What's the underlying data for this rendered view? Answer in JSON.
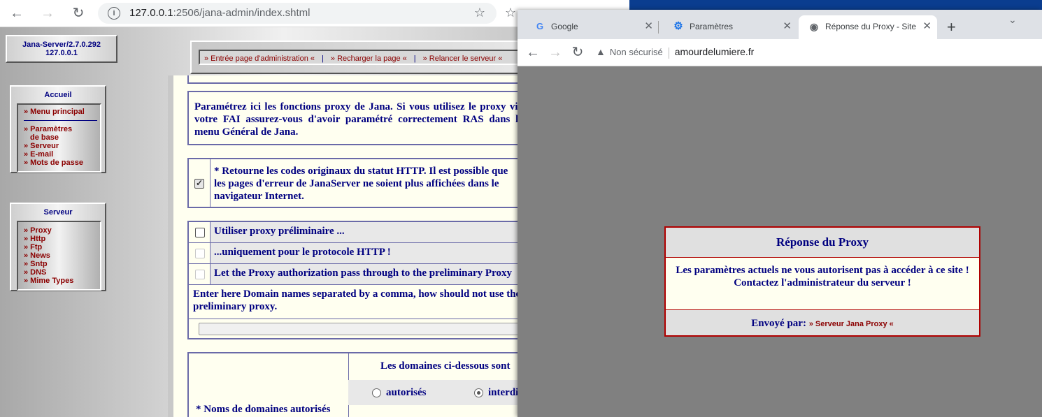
{
  "back_browser": {
    "url_host": "127.0.0.1",
    "url_rest": ":2506/jana-admin/index.shtml"
  },
  "jana": {
    "version_line1": "Jana-Server/2.7.0.292",
    "version_line2": "127.0.0.1",
    "menu_bar": [
      "» Entrée page d'administration «",
      "» Recharger la page «",
      "» Relancer le serveur «"
    ],
    "accueil": {
      "title": "Accueil",
      "items": [
        "» Menu principal",
        "» Paramètres",
        "de base",
        "» Serveur",
        "» E-mail",
        "» Mots de passe"
      ]
    },
    "serveur": {
      "title": "Serveur",
      "items": [
        "» Proxy",
        "» Http",
        "» Ftp",
        "» News",
        "» Sntp",
        "» DNS",
        "» Mime Types"
      ]
    },
    "intro": "Paramétrez ici les fonctions proxy de Jana. Si vous utilisez le proxy via votre FAI assurez-vous d'avoir paramétré correctement RAS dans le menu Général de Jana.",
    "http_codes": "* Retourne les codes originaux du statut HTTP. Il est possible que les pages d'erreur de JanaServer ne soient plus affichées dans le navigateur Internet.",
    "opt1": "Utiliser proxy préliminaire ...",
    "opt2": "...uniquement pour le protocole HTTP !",
    "opt3": "Let the Proxy authorization pass through to the preliminary Proxy",
    "domains_hint": "Enter here Domain names separated by a comma, how should not use the preliminary proxy.",
    "domains_title": "* Noms de domaines autorisés",
    "domains_header": "Les domaines ci-dessous sont",
    "radio_allowed": "autorisés",
    "radio_forbidden": "interdits"
  },
  "front_browser": {
    "tabs": [
      {
        "label": "Google",
        "icon": "google-icon"
      },
      {
        "label": "Paramètres",
        "icon": "gear-icon"
      },
      {
        "label": "Réponse du Proxy - Site ",
        "icon": "globe-icon"
      }
    ],
    "security": "Non sécurisé",
    "host": "amourdelumiere.fr"
  },
  "proxy_response": {
    "title": "Réponse du Proxy",
    "msg1": "Les paramètres actuels ne vous autorisent pas à accéder à ce site !",
    "msg2": "Contactez l'administrateur du serveur !",
    "sent_by": "Envoyé par:",
    "sender_link": "» Serveur Jana Proxy «"
  },
  "colors": {
    "accent_navy": "#000080",
    "link_red": "#8b0000",
    "box_border": "#b00000"
  }
}
